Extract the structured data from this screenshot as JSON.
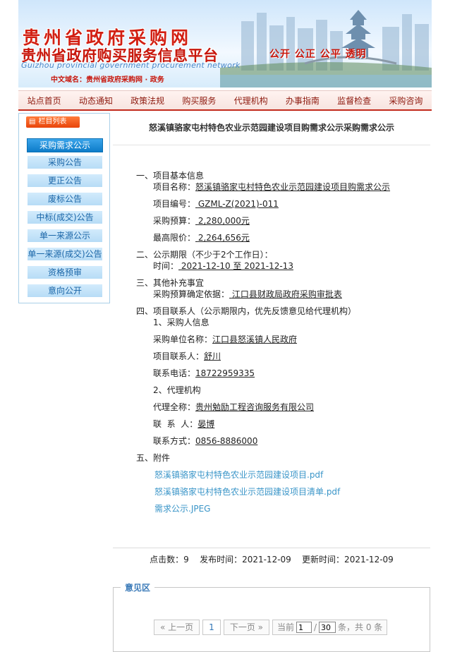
{
  "banner": {
    "title_cn": "贵州省政府采购网",
    "subtitle_cn": "贵州省政府购买服务信息平台",
    "title_en": "Guizhou provincial government procurement network",
    "domain_text": "中文域名：贵州省政府采购网 · 政务",
    "slogan": "公开  公正  公平  透明"
  },
  "nav": [
    "站点首页",
    "动态通知",
    "政策法规",
    "购买服务",
    "代理机构",
    "办事指南",
    "监督检查",
    "采购咨询"
  ],
  "sidebar": {
    "header": "栏目列表",
    "items": [
      "采购需求公示",
      "采购公告",
      "更正公告",
      "废标公告",
      "中标(成交)公告",
      "单一来源公示",
      "单一来源(成交)公告",
      "资格预审",
      "意向公开"
    ]
  },
  "article": {
    "title": "怒溪镇骆家屯村特色农业示范园建设项目购需求公示采购需求公示",
    "s1": "一、项目基本信息",
    "s1_name_label": "项目名称：",
    "s1_name_value": "怒溪镇骆家屯村特色农业示范园建设项目购需求公示",
    "s1_code_label": "项目编号：",
    "s1_code_value": "GZML-Z(2021)-011",
    "s1_budget_label": "采购预算：",
    "s1_budget_value": "2,280,000元",
    "s1_max_label": "最高限价：",
    "s1_max_value": "2,264,656元",
    "s2": "二、公示期限（不少于2个工作日）：",
    "s2_time_label": "时间：",
    "s2_time_value": "2021-12-10 至 2021-12-13",
    "s3": "三、其他补充事宜",
    "s3_basis_label": "采购预算确定依据：",
    "s3_basis_value": "江口县财政局政府采购审批表",
    "s4": "四、项目联系人（公示期限内，优先反馈意见给代理机构）",
    "s4_sub1": "1、采购人信息",
    "s4_unit_label": "采购单位名称：",
    "s4_unit_value": "江口县怒溪镇人民政府",
    "s4_contact_label": "项目联系人：",
    "s4_contact_value": "舒川",
    "s4_phone_label": "联系电话：",
    "s4_phone_value": "18722959335",
    "s4_sub2": "2、代理机构",
    "s4_agent_label": "代理全称：",
    "s4_agent_value": "贵州勉励工程咨询服务有限公司",
    "s4_person_label": "联  系  人：",
    "s4_person_value": "晏博",
    "s4_method_label": "联系方式：",
    "s4_method_value": "0856-8886000",
    "s5": "五、附件",
    "attachments": [
      "怒溪镇骆家屯村特色农业示范园建设项目.pdf",
      "怒溪镇骆家屯村特色农业示范园建设项目清单.pdf",
      "需求公示.JPEG"
    ]
  },
  "stats": {
    "text": "点击数：9    发布时间：2021-12-09    更新时间：2021-12-09"
  },
  "opinion": {
    "legend": "意见区",
    "prev": "« 上一页",
    "page": "1",
    "next": "下一页 »",
    "current_label": "当前",
    "current_value": "1",
    "total_prefix": "/",
    "total_value": "30",
    "total_suffix": "条，共 0 条"
  }
}
